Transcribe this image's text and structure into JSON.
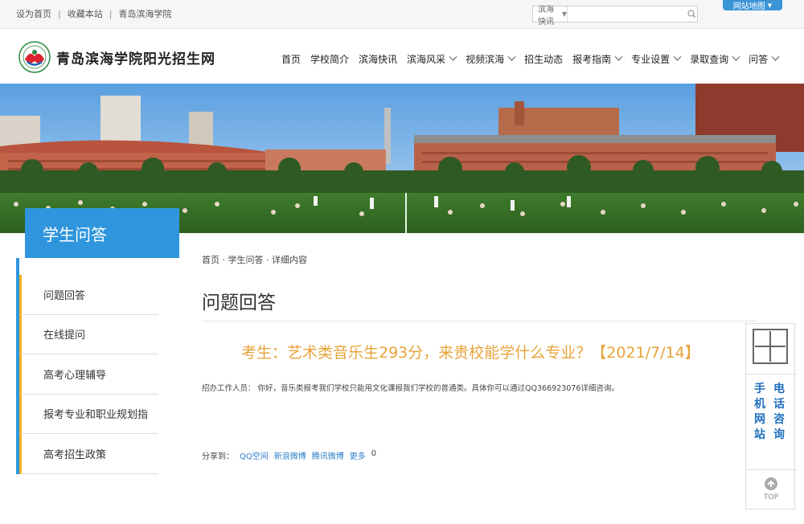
{
  "topbar": {
    "links": [
      "设为首页",
      "收藏本站",
      "青岛滨海学院"
    ],
    "search_select": "滨海快讯",
    "search_placeholder": "",
    "sitemap": "网站地图"
  },
  "header": {
    "logo_text": "青岛滨海学院阳光招生网",
    "nav": [
      {
        "label": "首页",
        "dropdown": false
      },
      {
        "label": "学校简介",
        "dropdown": false
      },
      {
        "label": "滨海快讯",
        "dropdown": false
      },
      {
        "label": "滨海风采",
        "dropdown": true
      },
      {
        "label": "视频滨海",
        "dropdown": true
      },
      {
        "label": "招生动态",
        "dropdown": false
      },
      {
        "label": "报考指南",
        "dropdown": true
      },
      {
        "label": "专业设置",
        "dropdown": true
      },
      {
        "label": "录取查询",
        "dropdown": true
      },
      {
        "label": "问答",
        "dropdown": true
      }
    ]
  },
  "sidebar": {
    "title": "学生问答",
    "items": [
      "问题回答",
      "在线提问",
      "高考心理辅导",
      "报考专业和职业规划指",
      "高考招生政策"
    ]
  },
  "main": {
    "breadcrumb": "首页 · 学生问答 · 详细内容",
    "page_title": "问题回答",
    "question": "考生：艺术类音乐生293分，来贵校能学什么专业？【2021/7/14】",
    "answer": "招办工作人员： 你好，音乐类报考我们学校只能用文化课报我们学校的普通类。具体你可以通过QQ366923076详细咨询。",
    "share_label": "分享到：",
    "share_links": [
      "QQ空间",
      "新浪微博",
      "腾讯微博",
      "更多"
    ],
    "share_count": "0"
  },
  "float_panel": {
    "col1": "手机网站",
    "col2": "电话咨询",
    "top": "TOP"
  },
  "colors": {
    "accent": "#2f96dd",
    "question": "#e8a33a",
    "side_border": "#f0b020"
  }
}
